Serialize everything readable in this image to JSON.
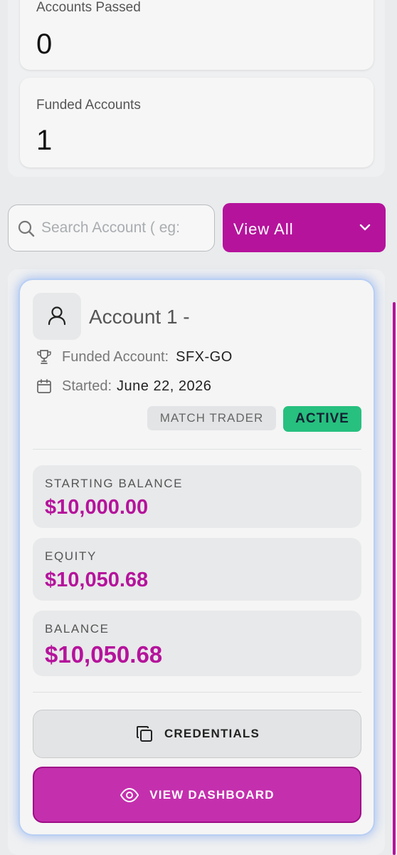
{
  "stats": [
    {
      "label": "Accounts Passed",
      "value": "0"
    },
    {
      "label": "Funded Accounts",
      "value": "1"
    }
  ],
  "search": {
    "placeholder": "Search Account ( eg:"
  },
  "filter": {
    "label": "View All"
  },
  "account": {
    "title": "Account 1 -",
    "type_label": "Funded Account:",
    "type_value": "SFX-GO",
    "started_label": "Started:",
    "started_value": "June 22, 2026",
    "platform_tag": "MATCH TRADER",
    "status_tag": "ACTIVE",
    "metrics": [
      {
        "label": "STARTING BALANCE",
        "value": "$10,000.00"
      },
      {
        "label": "EQUITY",
        "value": "$10,050.68"
      },
      {
        "label": "BALANCE",
        "value": "$10,050.68"
      }
    ],
    "credentials_label": "CREDENTIALS",
    "dashboard_label": "VIEW DASHBOARD"
  },
  "colors": {
    "accent": "#b5139c",
    "status_active": "#27c07f"
  },
  "icons": [
    "search-icon",
    "chevron-down-icon",
    "user-icon",
    "trophy-icon",
    "calendar-icon",
    "copy-icon",
    "eye-icon"
  ]
}
